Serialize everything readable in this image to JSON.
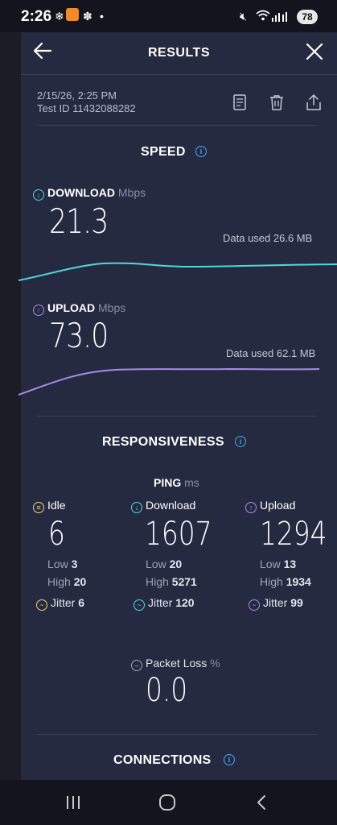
{
  "status_bar": {
    "time": "2:26",
    "battery": "78",
    "left_icons": [
      "snowflake-icon",
      "flower-icon",
      "dot-icon"
    ]
  },
  "header": {
    "title": "RESULTS"
  },
  "test_info": {
    "date": "2/15/26, 2:25 PM",
    "test_id": "Test ID 11432088282"
  },
  "speed": {
    "title": "SPEED",
    "download": {
      "label": "DOWNLOAD",
      "unit": "Mbps",
      "value": "21.3",
      "data_used": "Data used 26.6 MB",
      "color": "#4fd8d8"
    },
    "upload": {
      "label": "UPLOAD",
      "unit": "Mbps",
      "value": "73.0",
      "data_used": "Data used 62.1 MB",
      "color": "#a98aeb"
    }
  },
  "responsiveness": {
    "title": "RESPONSIVENESS",
    "ping_label": "PING",
    "ping_unit": "ms",
    "idle": {
      "label": "Idle",
      "value": "6",
      "low_label": "Low",
      "low": "3",
      "high_label": "High",
      "high": "20",
      "jitter_label": "Jitter",
      "jitter": "6",
      "color": "#e8d47a"
    },
    "download": {
      "label": "Download",
      "value": "1607",
      "low_label": "Low",
      "low": "20",
      "high_label": "High",
      "high": "5271",
      "jitter_label": "Jitter",
      "jitter": "120",
      "color": "#4fd8d8"
    },
    "upload": {
      "label": "Upload",
      "value": "1294",
      "low_label": "Low",
      "low": "13",
      "high_label": "High",
      "high": "1934",
      "jitter_label": "Jitter",
      "jitter": "99",
      "color": "#a98aeb"
    },
    "packet_loss": {
      "label": "Packet Loss",
      "unit": "%",
      "value": "0.0"
    }
  },
  "connections": {
    "title": "CONNECTIONS"
  }
}
